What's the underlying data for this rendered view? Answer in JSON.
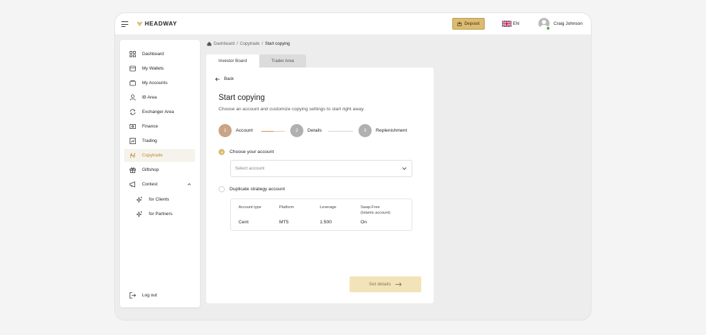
{
  "app": {
    "logo_text": "HEADWAY",
    "deposit_label": "Deposit",
    "language": "EN",
    "user_name": "Craig Johnson"
  },
  "sidebar": {
    "items": [
      {
        "label": "Dashboard",
        "icon": "grid-icon"
      },
      {
        "label": "My Wallets",
        "icon": "wallet-icon"
      },
      {
        "label": "My Accounts",
        "icon": "accounts-icon"
      },
      {
        "label": "IB Area",
        "icon": "person-icon"
      },
      {
        "label": "Exchanger Area",
        "icon": "exchange-icon"
      },
      {
        "label": "Finance",
        "icon": "money-icon"
      },
      {
        "label": "Trading",
        "icon": "chart-icon"
      },
      {
        "label": "Copytrade",
        "icon": "copytrade-icon",
        "active": true
      },
      {
        "label": "Giftshop",
        "icon": "gift-icon"
      },
      {
        "label": "Contest",
        "icon": "megaphone-icon",
        "expanded": true
      }
    ],
    "subitems": [
      {
        "label": "for Clients",
        "icon": "sparkle-icon"
      },
      {
        "label": "for Partners",
        "icon": "sparkle-icon"
      }
    ],
    "logout_label": "Log out"
  },
  "breadcrumb": [
    "Dashboard",
    "Copytrade",
    "Start copying"
  ],
  "tabs": [
    "Investor Board",
    "Trader Area"
  ],
  "main": {
    "back_label": "Back",
    "title": "Start copying",
    "subtitle": "Choose an account and customize copying settings to start right away.",
    "steps": [
      {
        "num": "1",
        "label": "Account"
      },
      {
        "num": "2",
        "label": "Details"
      },
      {
        "num": "3",
        "label": "Replenishment"
      }
    ],
    "option_choose": "Choose your account",
    "select_placeholder": "Select account",
    "option_duplicate": "Duplicate strategy account",
    "info": {
      "headers": [
        "Account type",
        "Platform",
        "Leverage",
        "Swap-Free\n(Islamic account)"
      ],
      "header_swap_1": "Swap-Free",
      "header_swap_2": "(Islamic account)",
      "values": [
        "Cent",
        "MT5",
        "1:500",
        "On"
      ]
    },
    "set_details_label": "Set details"
  },
  "colors": {
    "accent": "#dcbc70",
    "active_text": "#b88a2e",
    "step_active": "#c9a486",
    "step_inactive": "#b0b0b0"
  }
}
